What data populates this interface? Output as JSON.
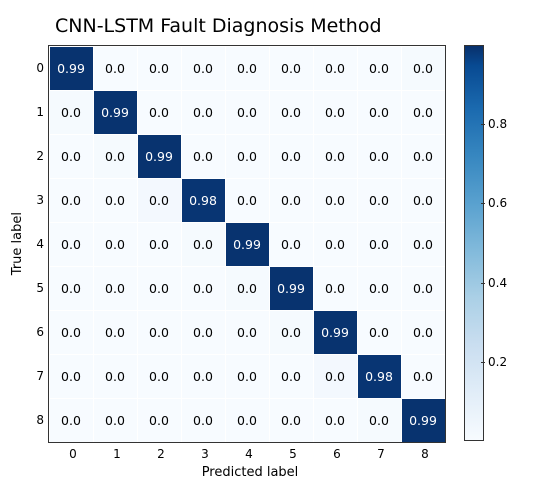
{
  "chart_data": {
    "type": "heatmap",
    "title": "CNN-LSTM Fault Diagnosis Method",
    "xlabel": "Predicted label",
    "ylabel": "True label",
    "xticks": [
      "0",
      "1",
      "2",
      "3",
      "4",
      "5",
      "6",
      "7",
      "8"
    ],
    "yticks": [
      "0",
      "1",
      "2",
      "3",
      "4",
      "5",
      "6",
      "7",
      "8"
    ],
    "colorbar_ticks": [
      {
        "value": "0.8",
        "pos": 80
      },
      {
        "value": "0.6",
        "pos": 60
      },
      {
        "value": "0.4",
        "pos": 40
      },
      {
        "value": "0.2",
        "pos": 20
      }
    ],
    "vmin": 0.0,
    "vmax": 1.0,
    "matrix": [
      [
        0.99,
        0.0,
        0.0,
        0.0,
        0.0,
        0.0,
        0.0,
        0.0,
        0.01
      ],
      [
        0.01,
        0.99,
        0.0,
        0.0,
        0.0,
        0.0,
        0.0,
        0.0,
        0.0
      ],
      [
        0.0,
        0.01,
        0.99,
        0.0,
        0.0,
        0.0,
        0.0,
        0.0,
        0.0
      ],
      [
        0.0,
        0.0,
        0.02,
        0.98,
        0.0,
        0.0,
        0.0,
        0.0,
        0.0
      ],
      [
        0.0,
        0.0,
        0.0,
        0.01,
        0.99,
        0.0,
        0.0,
        0.0,
        0.0
      ],
      [
        0.0,
        0.0,
        0.0,
        0.0,
        0.01,
        0.99,
        0.0,
        0.0,
        0.0
      ],
      [
        0.0,
        0.0,
        0.0,
        0.0,
        0.0,
        0.01,
        0.99,
        0.0,
        0.0
      ],
      [
        0.0,
        0.0,
        0.0,
        0.0,
        0.0,
        0.0,
        0.02,
        0.98,
        0.0
      ],
      [
        0.0,
        0.0,
        0.0,
        0.0,
        0.0,
        0.0,
        0.0,
        0.01,
        0.99
      ]
    ]
  }
}
